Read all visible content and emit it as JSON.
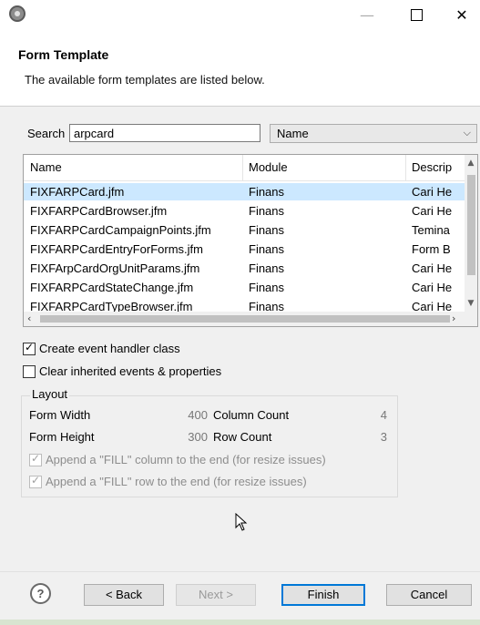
{
  "window": {
    "minimize_glyph": "—",
    "close_glyph": "✕"
  },
  "header": {
    "title": "Form Template",
    "description": "The available form templates are listed below."
  },
  "search": {
    "label": "Search",
    "value": "arpcard"
  },
  "filter_combo": {
    "selected": "Name",
    "arrow": "⌵"
  },
  "table": {
    "columns": [
      "Name",
      "Module",
      "Descrip"
    ],
    "rows": [
      {
        "name": "FIXFARPCard.jfm",
        "module": "Finans",
        "desc": "Cari He",
        "selected": true
      },
      {
        "name": "FIXFARPCardBrowser.jfm",
        "module": "Finans",
        "desc": "Cari He"
      },
      {
        "name": "FIXFARPCardCampaignPoints.jfm",
        "module": "Finans",
        "desc": "Temina"
      },
      {
        "name": "FIXFARPCardEntryForForms.jfm",
        "module": "Finans",
        "desc": "Form B"
      },
      {
        "name": "FIXFArpCardOrgUnitParams.jfm",
        "module": "Finans",
        "desc": "Cari He"
      },
      {
        "name": "FIXFARPCardStateChange.jfm",
        "module": "Finans",
        "desc": "Cari He"
      },
      {
        "name": "FIXFARPCardTypeBrowser.jfm",
        "module": "Finans",
        "desc": "Cari He"
      }
    ]
  },
  "options": {
    "create_event_handler": {
      "label": "Create event handler class",
      "checked": true
    },
    "clear_inherited": {
      "label": "Clear inherited events & properties",
      "checked": false
    }
  },
  "layout": {
    "title": "Layout",
    "form_width_label": "Form Width",
    "form_width": "400",
    "form_height_label": "Form Height",
    "form_height": "300",
    "column_count_label": "Column Count",
    "column_count": "4",
    "row_count_label": "Row Count",
    "row_count": "3",
    "append_fill_column": "Append a \"FILL\" column to the end (for resize issues)",
    "append_fill_row": "Append a \"FILL\" row to the end (for resize issues)"
  },
  "footer": {
    "help": "?",
    "back": "< Back",
    "next": "Next >",
    "finish": "Finish",
    "cancel": "Cancel"
  }
}
